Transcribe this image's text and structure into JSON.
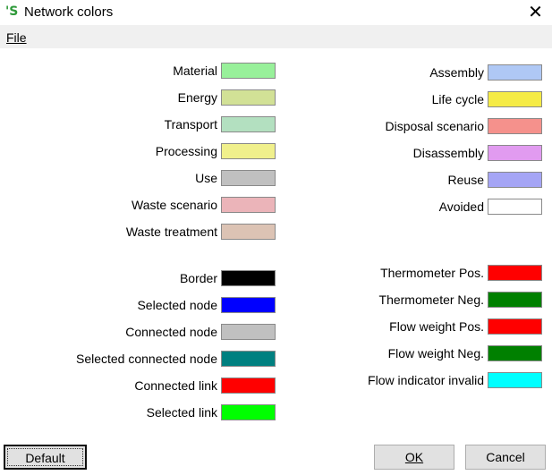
{
  "window": {
    "title": "Network colors",
    "close_glyph": "✕"
  },
  "menu": {
    "file": "File"
  },
  "left_groups": [
    [
      {
        "label": "Material",
        "color": "#98f09a"
      },
      {
        "label": "Energy",
        "color": "#d2e196"
      },
      {
        "label": "Transport",
        "color": "#b3e0c0"
      },
      {
        "label": "Processing",
        "color": "#f0f08c"
      },
      {
        "label": "Use",
        "color": "#c0c0c0"
      },
      {
        "label": "Waste scenario",
        "color": "#ebb4b9"
      },
      {
        "label": "Waste treatment",
        "color": "#dcc3b4"
      }
    ],
    [
      {
        "label": "Border",
        "color": "#000000"
      },
      {
        "label": "Selected node",
        "color": "#0000ff"
      },
      {
        "label": "Connected node",
        "color": "#c0c0c0"
      },
      {
        "label": "Selected connected node",
        "color": "#008080"
      },
      {
        "label": "Connected link",
        "color": "#ff0000"
      },
      {
        "label": "Selected link",
        "color": "#00ff00"
      }
    ]
  ],
  "right_groups": [
    [
      {
        "label": "Assembly",
        "color": "#afc8f5"
      },
      {
        "label": "Life cycle",
        "color": "#f5eb46"
      },
      {
        "label": "Disposal scenario",
        "color": "#f5918c"
      },
      {
        "label": "Disassembly",
        "color": "#e19bf0"
      },
      {
        "label": "Reuse",
        "color": "#a5a5f5"
      },
      {
        "label": "Avoided",
        "color": "#ffffff"
      }
    ],
    [
      {
        "label": "Thermometer Pos.",
        "color": "#ff0000"
      },
      {
        "label": "Thermometer Neg.",
        "color": "#008000"
      },
      {
        "label": "Flow weight Pos.",
        "color": "#ff0000"
      },
      {
        "label": "Flow weight Neg.",
        "color": "#008000"
      },
      {
        "label": "Flow indicator invalid",
        "color": "#00ffff"
      }
    ]
  ],
  "buttons": {
    "default": "Default",
    "ok": "OK",
    "cancel": "Cancel"
  }
}
